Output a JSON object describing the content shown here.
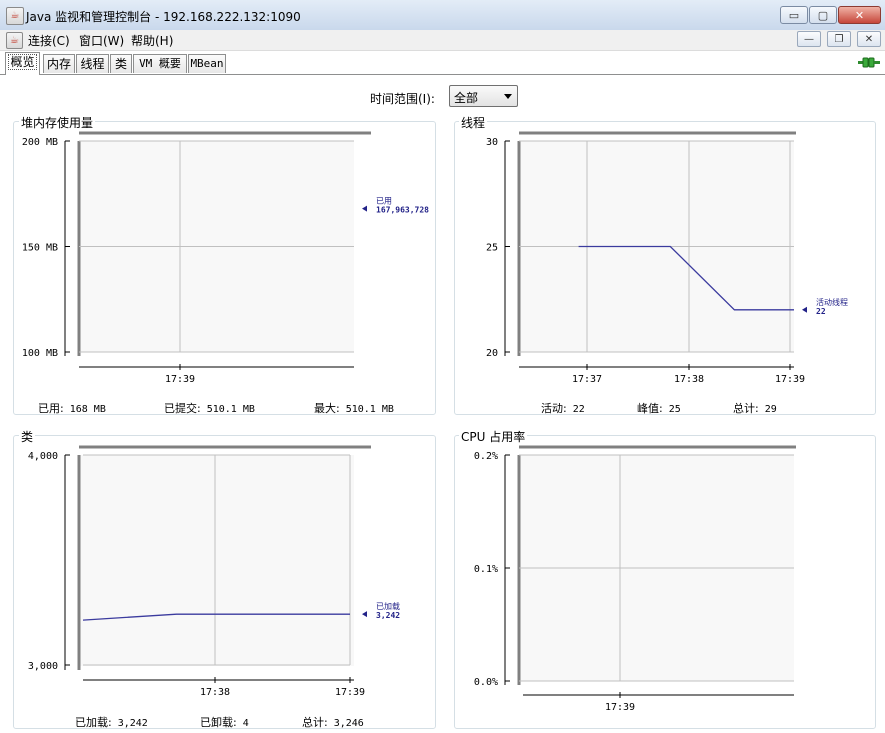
{
  "window": {
    "title": "Java 监视和管理控制台 - 192.168.222.132:1090",
    "app_icon": "java-cup-icon",
    "btn_minimize": "▭",
    "btn_maximize": "▢",
    "btn_close": "✕"
  },
  "menu": {
    "items": [
      "连接(C)",
      "窗口(W)",
      "帮助(H)"
    ],
    "btn_minimize": "—",
    "btn_restore": "❐",
    "btn_close": "✕"
  },
  "tabs": [
    "概览",
    "内存",
    "线程",
    "类",
    "VM 概要",
    "MBean"
  ],
  "active_tab": "概览",
  "time_range": {
    "label": "时间范围(I):",
    "value": "全部"
  },
  "colors": {
    "series": "#3b3b9e",
    "grid": "#c0c0c0",
    "plot_bg": "#f8f8f8"
  },
  "panels": {
    "heap": {
      "title": "堆内存使用量",
      "stats": [
        {
          "label": "已用:",
          "value": "168  MB"
        },
        {
          "label": "已提交:",
          "value": "510.1  MB"
        },
        {
          "label": "最大:",
          "value": "510.1  MB"
        }
      ]
    },
    "threads": {
      "title": "线程",
      "stats": [
        {
          "label": "活动:",
          "value": "22"
        },
        {
          "label": "峰值:",
          "value": "25"
        },
        {
          "label": "总计:",
          "value": "29"
        }
      ]
    },
    "classes": {
      "title": "类",
      "stats": [
        {
          "label": "已加载:",
          "value": "3,242"
        },
        {
          "label": "已卸载:",
          "value": "4"
        },
        {
          "label": "总计:",
          "value": "3,246"
        }
      ]
    },
    "cpu": {
      "title": "CPU 占用率"
    }
  },
  "chart_data": [
    {
      "id": "heap",
      "type": "line",
      "ylim": [
        100,
        200
      ],
      "yticks": [
        "200 MB",
        "150 MB",
        "100 MB"
      ],
      "xticks": [
        "17:39"
      ],
      "series": [
        {
          "name": "已用",
          "x": [],
          "values": []
        }
      ],
      "marker": {
        "label": "已用",
        "value": "167,963,728",
        "y": 167.96
      }
    },
    {
      "id": "threads",
      "type": "line",
      "ylim": [
        20,
        30
      ],
      "yticks": [
        "30",
        "25",
        "20"
      ],
      "xticks": [
        "17:37",
        "17:38",
        "17:39"
      ],
      "series": [
        {
          "name": "活动线程",
          "x": [
            "17:36.65",
            "17:37.65",
            "17:38.35",
            "17:39"
          ],
          "values": [
            25,
            25,
            22,
            22
          ]
        }
      ],
      "marker": {
        "label": "活动线程",
        "value": "22",
        "y": 22
      }
    },
    {
      "id": "classes",
      "type": "line",
      "ylim": [
        3000,
        4000
      ],
      "yticks": [
        "4,000",
        "3,000"
      ],
      "xticks": [
        "17:38",
        "17:39"
      ],
      "series": [
        {
          "name": "已加载",
          "x": [
            "17:37.0",
            "17:37.7",
            "17:39"
          ],
          "values": [
            3214,
            3242,
            3242
          ]
        }
      ],
      "marker": {
        "label": "已加载",
        "value": "3,242",
        "y": 3242
      }
    },
    {
      "id": "cpu",
      "type": "line",
      "ylim": [
        0,
        0.2
      ],
      "yticks": [
        "0.2%",
        "0.1%",
        "0.0%"
      ],
      "xticks": [
        "17:39"
      ],
      "series": []
    }
  ]
}
